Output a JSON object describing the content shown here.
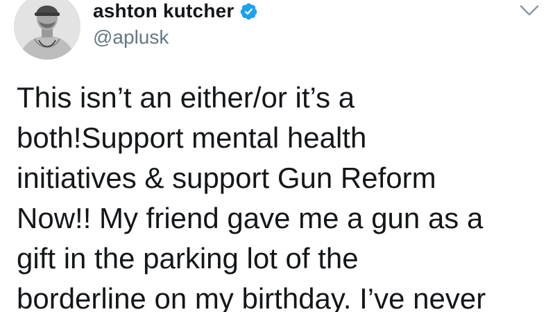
{
  "tweet": {
    "author": {
      "display_name": "ashton kutcher",
      "handle": "@aplusk",
      "verified": true,
      "avatar": "profile-photo"
    },
    "text": "This isn’t an either/or it’s a\nboth!Support mental health\ninitiatives & support Gun Reform\nNow!! My friend gave me a gun as a\ngift in the parking lot of the\nborderline on my birthday. I’ve never",
    "menu_icon": "chevron-down-icon"
  },
  "colors": {
    "verified_blue": "#1da1f2",
    "handle_gray": "#657786",
    "text": "#14171a",
    "chevron": "#8899a6"
  }
}
